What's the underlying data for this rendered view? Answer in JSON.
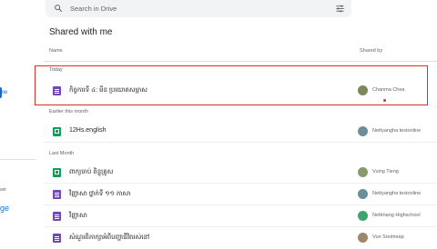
{
  "sidebar": {
    "active_item_fragment": "me",
    "storage_fragment": "set",
    "link_fragment": "ge"
  },
  "search": {
    "placeholder": "Search in Drive",
    "icon": "search-icon",
    "filter_icon": "tune-icon"
  },
  "page": {
    "title": "Shared with me",
    "columns": {
      "name": "Name",
      "shared_by": "Shared by"
    }
  },
  "sections": [
    {
      "label": "Today",
      "rows": [
        {
          "type": "form",
          "name": "កិច្ចការទី ៤: មីន ប្រយោគសម្ភាស",
          "owner": "Chanma Chea",
          "avatar_color": "#7a8a5a"
        }
      ]
    },
    {
      "label": "Earlier this month",
      "rows": [
        {
          "type": "sheet",
          "name": "12Hs.english",
          "owner": "Nettyangha testonline",
          "avatar_color": "#6b8f9a"
        }
      ]
    },
    {
      "label": "Last Month",
      "rows": [
        {
          "type": "sheet",
          "name": "ពាក្យចាប់ ពិន្ទុគ្រូស",
          "owner": "Vuing Tieng",
          "avatar_color": "#8a9a6a"
        },
        {
          "type": "form",
          "name": "វិញ្ញាសា ថ្នាក់ទី ១១ ភាសា",
          "owner": "Nettyangha testonline",
          "avatar_color": "#6b8f9a"
        },
        {
          "type": "form",
          "name": "វិញ្ញាសា",
          "owner": "Nettmang Highschool",
          "avatar_color": "#3aa66a"
        },
        {
          "type": "form",
          "name": "សំណួរពិភាក្សាអំពីបញ្ហាជីវិតរស់នៅ",
          "owner": "Vun Sreimeap",
          "avatar_color": "#9a8a6a"
        }
      ]
    }
  ],
  "colors": {
    "highlight": "#d93025",
    "accent": "#1967d2"
  }
}
